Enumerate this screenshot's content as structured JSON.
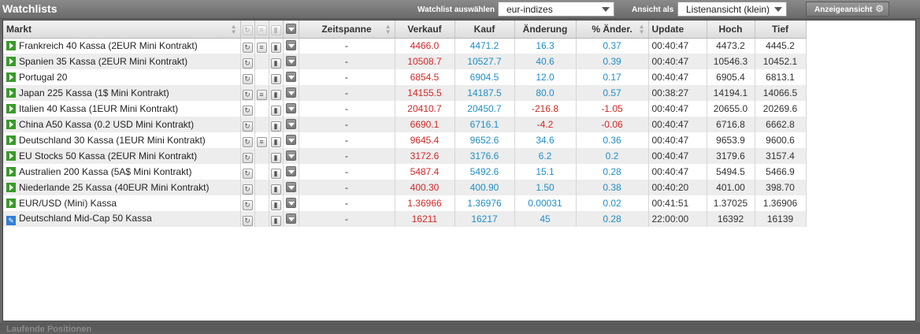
{
  "window": {
    "title": "Watchlists",
    "watchlist_label": "Watchlist auswählen",
    "watchlist_value": "eur-indizes",
    "view_label": "Ansicht als",
    "view_value": "Listenansicht (klein)",
    "display_button": "Anzeigeansicht",
    "bottom_text": "Laufende Positionen"
  },
  "columns": {
    "markt": "Markt",
    "zeitspanne": "Zeitspanne",
    "verkauf": "Verkauf",
    "kauf": "Kauf",
    "aenderung": "Änderung",
    "pct": "% Änder.",
    "update": "Update",
    "hoch": "Hoch",
    "tief": "Tief"
  },
  "rows": [
    {
      "name": "Frankreich 40 Kassa (2EUR Mini Kontrakt)",
      "icon": "play",
      "info": true,
      "zeit": "-",
      "verkauf": "4466.0",
      "kauf": "4471.2",
      "aend": "16.3",
      "pct": "0.37",
      "update": "00:40:47",
      "hoch": "4473.2",
      "tief": "4445.2",
      "neg": false
    },
    {
      "name": "Spanien 35 Kassa (2EUR Mini Kontrakt)",
      "icon": "play",
      "info": false,
      "zeit": "-",
      "verkauf": "10508.7",
      "kauf": "10527.7",
      "aend": "40.6",
      "pct": "0.39",
      "update": "00:40:47",
      "hoch": "10546.3",
      "tief": "10452.1",
      "neg": false
    },
    {
      "name": "Portugal 20",
      "icon": "play",
      "info": false,
      "zeit": "-",
      "verkauf": "6854.5",
      "kauf": "6904.5",
      "aend": "12.0",
      "pct": "0.17",
      "update": "00:40:47",
      "hoch": "6905.4",
      "tief": "6813.1",
      "neg": false
    },
    {
      "name": "Japan 225 Kassa (1$ Mini Kontrakt)",
      "icon": "play",
      "info": true,
      "zeit": "-",
      "verkauf": "14155.5",
      "kauf": "14187.5",
      "aend": "80.0",
      "pct": "0.57",
      "update": "00:38:27",
      "hoch": "14194.1",
      "tief": "14066.5",
      "neg": false
    },
    {
      "name": "Italien 40 Kassa (1EUR Mini Kontrakt)",
      "icon": "play",
      "info": false,
      "zeit": "-",
      "verkauf": "20410.7",
      "kauf": "20450.7",
      "aend": "-216.8",
      "pct": "-1.05",
      "update": "00:40:47",
      "hoch": "20655.0",
      "tief": "20269.6",
      "neg": true
    },
    {
      "name": "China A50 Kassa (0.2 USD Mini Kontrakt)",
      "icon": "play",
      "info": false,
      "zeit": "-",
      "verkauf": "6690.1",
      "kauf": "6716.1",
      "aend": "-4.2",
      "pct": "-0.06",
      "update": "00:40:47",
      "hoch": "6716.8",
      "tief": "6662.8",
      "neg": true
    },
    {
      "name": "Deutschland 30 Kassa (1EUR Mini Kontrakt)",
      "icon": "play",
      "info": true,
      "zeit": "-",
      "verkauf": "9645.4",
      "kauf": "9652.6",
      "aend": "34.6",
      "pct": "0.36",
      "update": "00:40:47",
      "hoch": "9653.9",
      "tief": "9600.6",
      "neg": false
    },
    {
      "name": "EU Stocks 50 Kassa (2EUR Mini Kontrakt)",
      "icon": "play",
      "info": false,
      "zeit": "-",
      "verkauf": "3172.6",
      "kauf": "3176.6",
      "aend": "6.2",
      "pct": "0.2",
      "update": "00:40:47",
      "hoch": "3179.6",
      "tief": "3157.4",
      "neg": false
    },
    {
      "name": "Australien 200 Kassa (5A$ Mini Kontrakt)",
      "icon": "play",
      "info": false,
      "zeit": "-",
      "verkauf": "5487.4",
      "kauf": "5492.6",
      "aend": "15.1",
      "pct": "0.28",
      "update": "00:40:47",
      "hoch": "5494.5",
      "tief": "5466.9",
      "neg": false
    },
    {
      "name": "Niederlande 25 Kassa (40EUR Mini Kontrakt)",
      "icon": "play",
      "info": false,
      "zeit": "-",
      "verkauf": "400.30",
      "kauf": "400.90",
      "aend": "1.50",
      "pct": "0.38",
      "update": "00:40:20",
      "hoch": "401.00",
      "tief": "398.70",
      "neg": false
    },
    {
      "name": "EUR/USD (Mini) Kassa",
      "icon": "play",
      "info": false,
      "zeit": "-",
      "verkauf": "1.36966",
      "kauf": "1.36976",
      "aend": "0.00031",
      "pct": "0.02",
      "update": "00:41:51",
      "hoch": "1.37025",
      "tief": "1.36906",
      "neg": false
    },
    {
      "name": "Deutschland Mid-Cap 50 Kassa",
      "icon": "pen",
      "info": false,
      "zeit": "-",
      "verkauf": "16211",
      "kauf": "16217",
      "aend": "45",
      "pct": "0.28",
      "update": "22:00:00",
      "hoch": "16392",
      "tief": "16139",
      "neg": false
    }
  ]
}
